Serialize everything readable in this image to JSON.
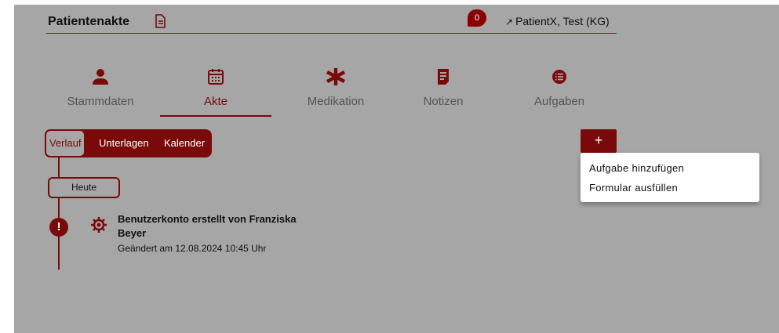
{
  "header": {
    "title": "Patientenakte",
    "badge_count": "0",
    "patient_name": "PatientX, Test (KG)"
  },
  "tabs": [
    {
      "label": "Stammdaten",
      "icon": "person-icon"
    },
    {
      "label": "Akte",
      "icon": "calendar-icon"
    },
    {
      "label": "Medikation",
      "icon": "asterisk-icon"
    },
    {
      "label": "Notizen",
      "icon": "note-icon"
    },
    {
      "label": "Aufgaben",
      "icon": "list-icon"
    }
  ],
  "active_tab": "Akte",
  "segments": [
    "Verlauf",
    "Unterlagen",
    "Kalender"
  ],
  "selected_segment": "Verlauf",
  "add_button": "+",
  "menu": {
    "items": [
      "Aufgabe hinzufügen",
      "Formular ausfüllen"
    ]
  },
  "timeline": {
    "today_label": "Heute",
    "event": {
      "title": "Benutzerkonto erstellt von Franziska Beyer",
      "changed": "Geändert am 12.08.2024 10:45 Uhr"
    }
  },
  "colors": {
    "accent": "#7a0a0a",
    "overlay": "#a6a6a6",
    "menu_bg": "#ffffff"
  }
}
